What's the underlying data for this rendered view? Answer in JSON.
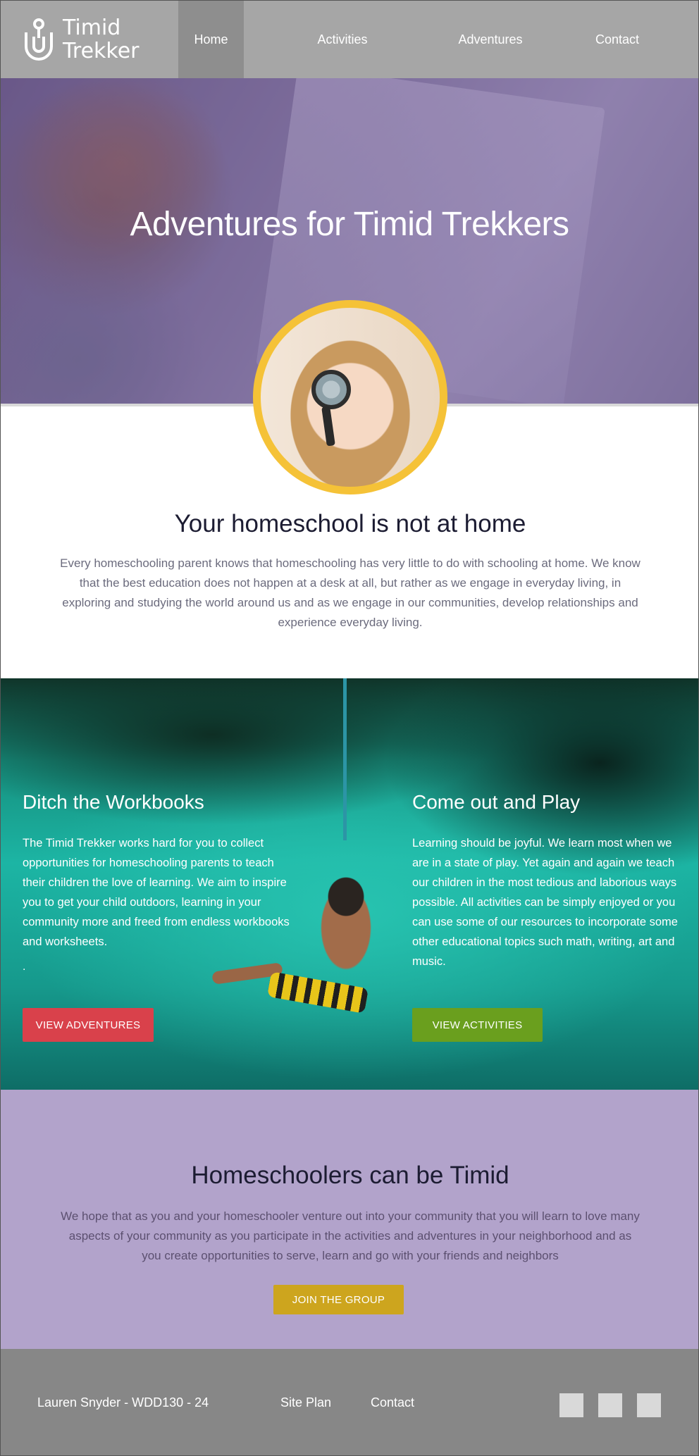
{
  "brand": {
    "name_line1": "Timid",
    "name_line2": "Trekker"
  },
  "nav": {
    "items": [
      "Home",
      "Activities",
      "Adventures",
      "Contact"
    ],
    "active": "Home"
  },
  "hero": {
    "title": "Adventures for Timid Trekkers"
  },
  "intro": {
    "heading": "Your homeschool is not at home",
    "body": "Every homeschooling parent knows that homeschooling has very little to do with schooling at home. We know that the best education does not happen at a desk at all, but rather as we engage in everyday living, in exploring and studying the world around us and as we engage in our communities, develop relationships and experience everyday living."
  },
  "features": {
    "left": {
      "heading": "Ditch the Workbooks",
      "body": "The Timid Trekker works hard for you to collect opportunities for homeschooling parents to teach their children the love of learning. We aim to inspire you to get your child outdoors, learning in your community more and freed from endless workbooks and worksheets.",
      "extra": ".",
      "button": "VIEW ADVENTURES"
    },
    "right": {
      "heading": "Come out and Play",
      "body": "Learning should be joyful. We learn most when we are in a state of play. Yet again and again we teach our children in the most tedious and laborious ways possible. All activities can be simply enjoyed or you can use some of our resources to incorporate some other educational topics such math, writing, art and music.",
      "button": "VIEW ACTIVITIES"
    }
  },
  "group": {
    "heading": "Homeschoolers can be Timid",
    "body": "We hope that as you and your homeschooler venture out into your community that you will learn to love many aspects of your community as you participate in the activities and adventures in your neighborhood and as you create opportunities to serve, learn and go with your friends and neighbors",
    "button": "JOIN THE GROUP"
  },
  "footer": {
    "credit": "Lauren Snyder - WDD130 - 24",
    "links": [
      "Site Plan",
      "Contact"
    ]
  },
  "colors": {
    "header": "#a6a6a6",
    "active_nav": "#8e8e8e",
    "avatar_ring": "#f5c237",
    "btn_adventures": "#d9414b",
    "btn_activities": "#6a9f1e",
    "group_bg": "#b2a3cb",
    "btn_join": "#cda51e",
    "footer_bg": "#878787"
  }
}
